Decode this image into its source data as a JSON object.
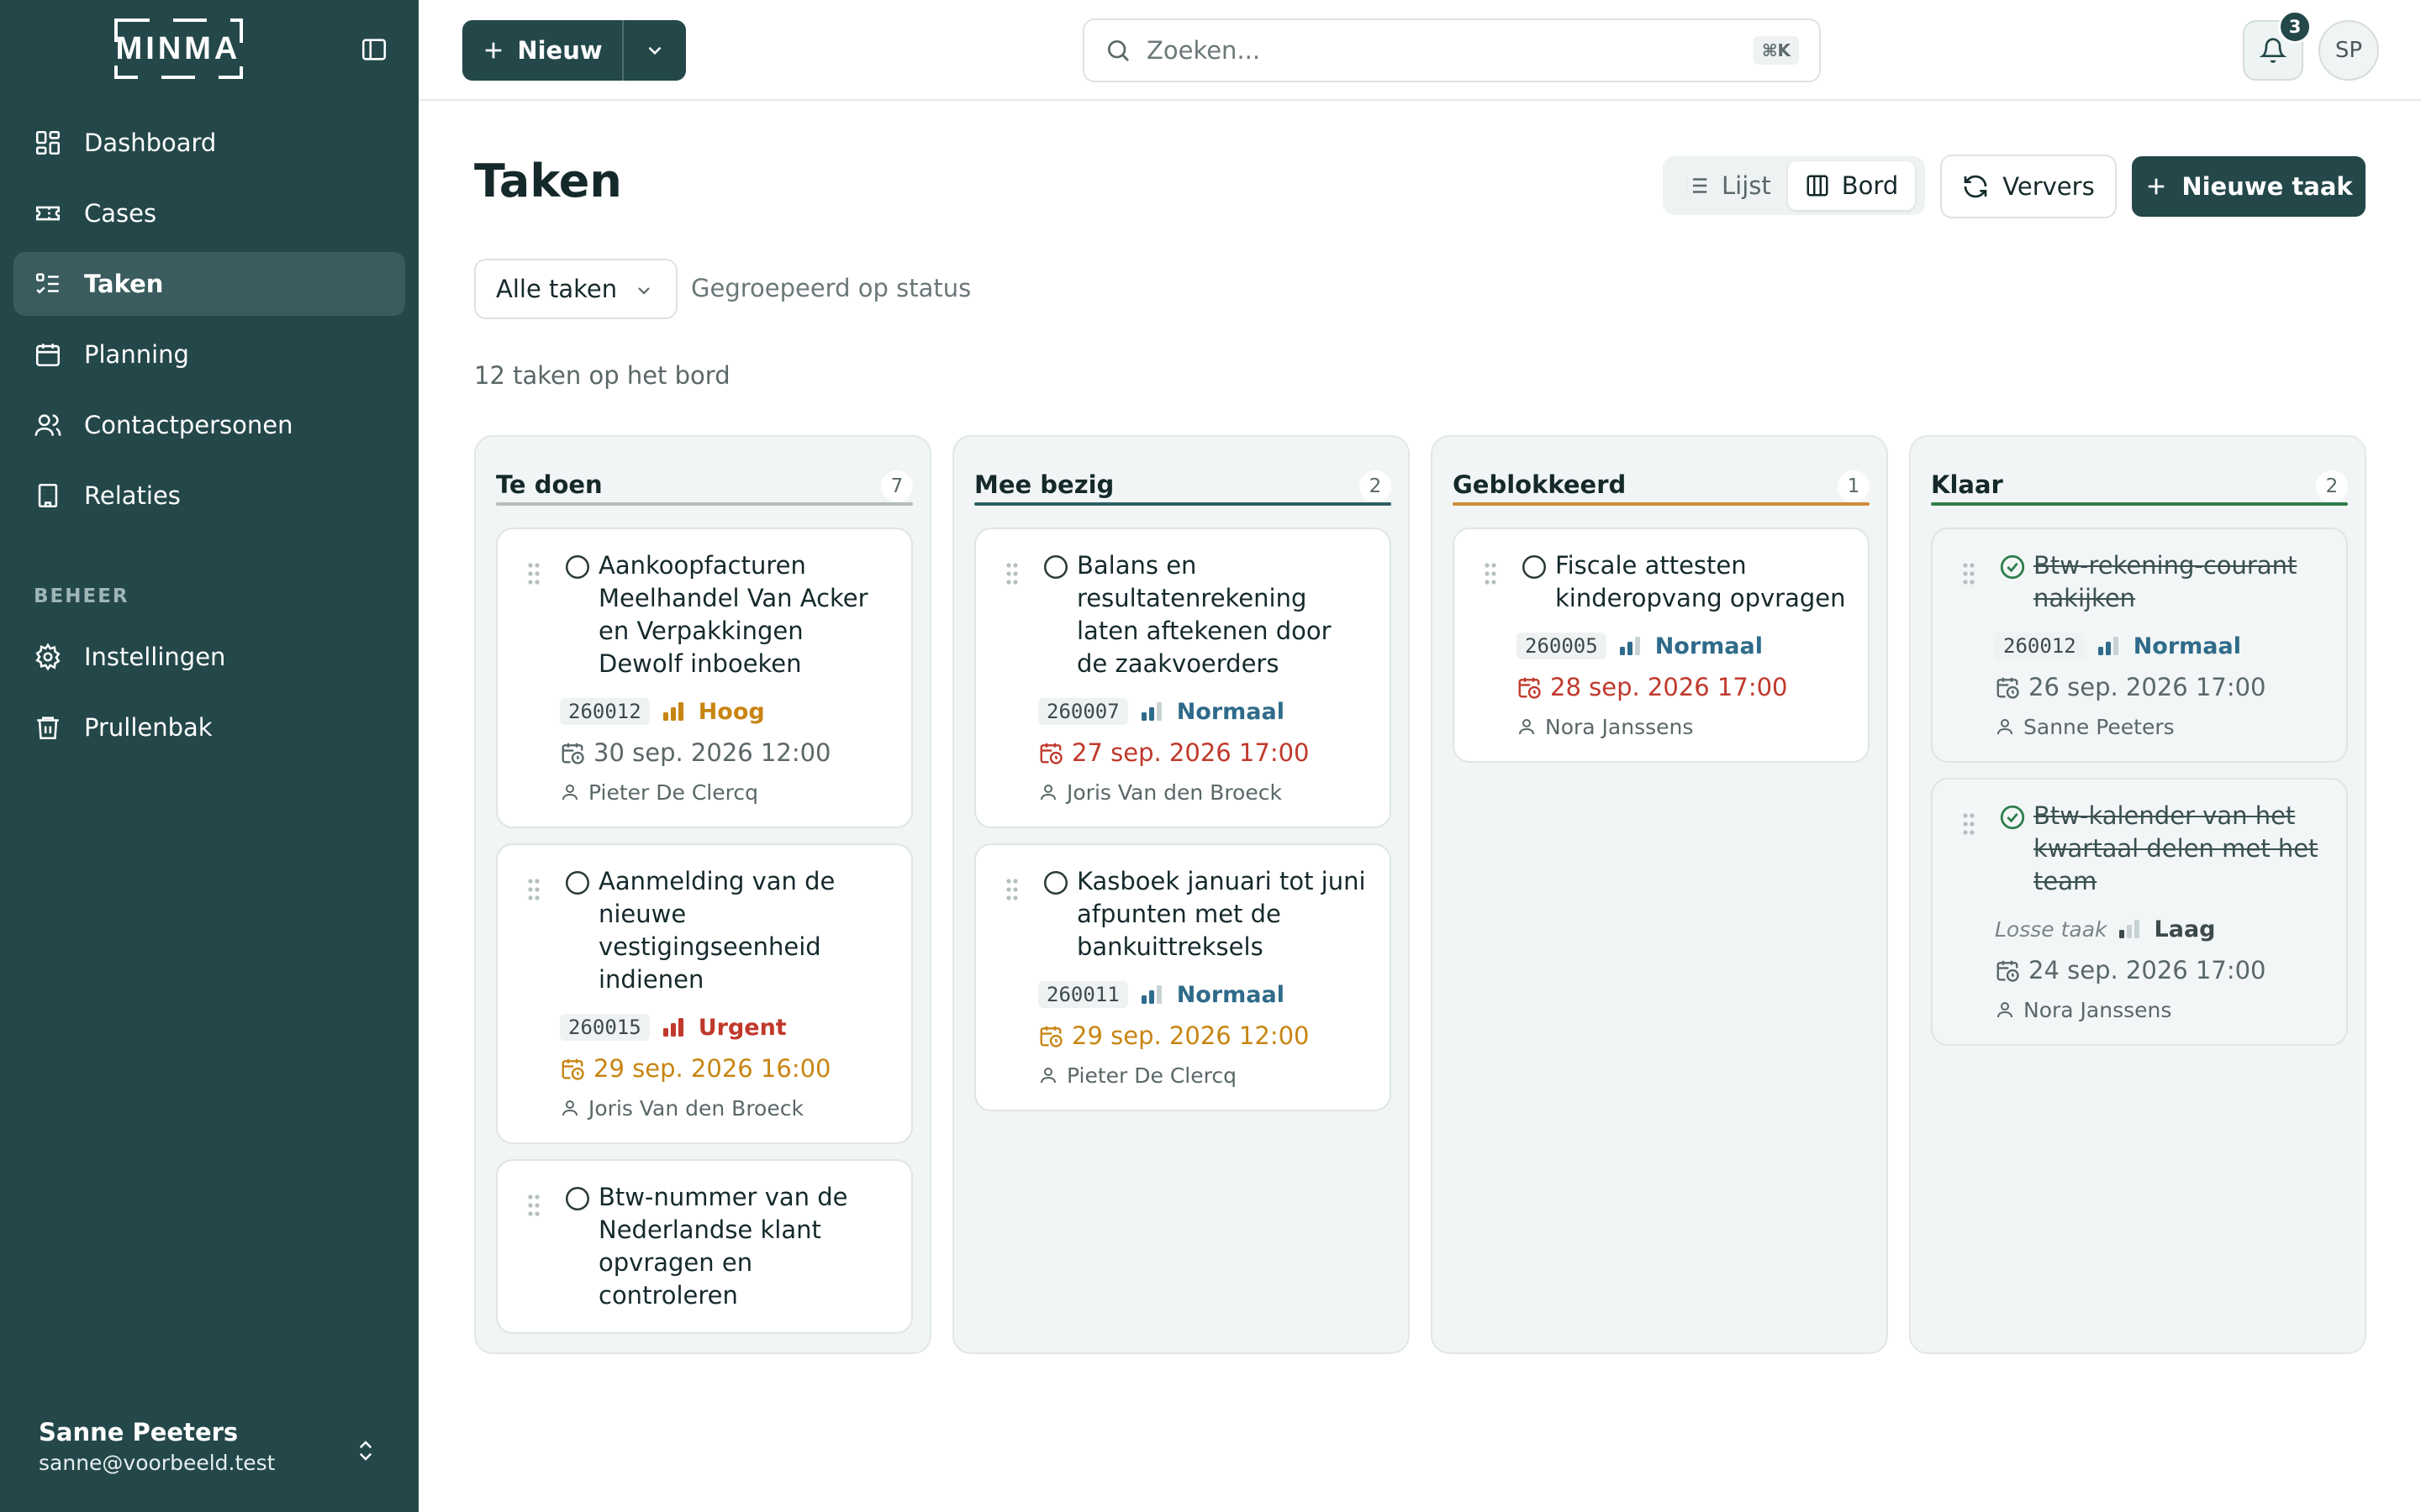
{
  "brand": {
    "logo_text": "MINMA"
  },
  "sidebar": {
    "items": [
      {
        "label": "Dashboard",
        "icon": "dashboard-icon"
      },
      {
        "label": "Cases",
        "icon": "ticket-icon"
      },
      {
        "label": "Taken",
        "icon": "tasks-icon"
      },
      {
        "label": "Planning",
        "icon": "calendar-icon"
      },
      {
        "label": "Contactpersonen",
        "icon": "users-icon"
      },
      {
        "label": "Relaties",
        "icon": "building-icon"
      }
    ],
    "section_label": "BEHEER",
    "admin_items": [
      {
        "label": "Instellingen",
        "icon": "gear-icon"
      },
      {
        "label": "Prullenbak",
        "icon": "trash-icon"
      }
    ],
    "user": {
      "name": "Sanne Peeters",
      "email": "sanne@voorbeeld.test"
    }
  },
  "topbar": {
    "new_label": "Nieuw",
    "search_placeholder": "Zoeken...",
    "search_shortcut": "⌘K",
    "notification_count": "3",
    "avatar_initials": "SP"
  },
  "page": {
    "title": "Taken",
    "view_toggle": {
      "list_label": "Lijst",
      "board_label": "Bord",
      "active": "Bord"
    },
    "refresh_label": "Ververs",
    "new_task_label": "Nieuwe taak",
    "filter": {
      "selected": "Alle taken"
    },
    "grouping_label": "Gegroepeerd op status",
    "count_label": "12 taken op het bord"
  },
  "colors": {
    "brand": "#24474a",
    "todo_line": "#b4bcbc",
    "busy_line": "#2f5f63",
    "blocked_line": "#d08a3c",
    "done_line": "#2e7d4c",
    "prio_high": "#c88512",
    "prio_normal": "#2f6b8a",
    "prio_urgent": "#c0392b",
    "prio_low": "#3d4a4b",
    "due_overdue": "#c0392b",
    "due_soon": "#c88512",
    "due_normal": "#5a6768"
  },
  "board": {
    "columns": [
      {
        "title": "Te doen",
        "count": "7",
        "cards": [
          {
            "title": "Aankoopfacturen Meelhandel Van Acker en Verpakkingen Dewolf inboeken",
            "code": "260012",
            "priority": "Hoog",
            "priority_level": "high",
            "due": "30 sep. 2026 12:00",
            "due_state": "normal",
            "assignee": "Pieter De Clercq",
            "done": false
          },
          {
            "title": "Aanmelding van de nieuwe vestigingseenheid indienen",
            "code": "260015",
            "priority": "Urgent",
            "priority_level": "urgent",
            "due": "29 sep. 2026 16:00",
            "due_state": "soon",
            "assignee": "Joris Van den Broeck",
            "done": false
          },
          {
            "title": "Btw-nummer van de Nederlandse klant opvragen en controleren",
            "done": false
          }
        ]
      },
      {
        "title": "Mee bezig",
        "count": "2",
        "cards": [
          {
            "title": "Balans en resultatenrekening laten aftekenen door de zaakvoerders",
            "code": "260007",
            "priority": "Normaal",
            "priority_level": "normal",
            "due": "27 sep. 2026 17:00",
            "due_state": "overdue",
            "assignee": "Joris Van den Broeck",
            "done": false
          },
          {
            "title": "Kasboek januari tot juni afpunten met de bankuittreksels",
            "code": "260011",
            "priority": "Normaal",
            "priority_level": "normal",
            "due": "29 sep. 2026 12:00",
            "due_state": "soon",
            "assignee": "Pieter De Clercq",
            "done": false
          }
        ]
      },
      {
        "title": "Geblokkeerd",
        "count": "1",
        "cards": [
          {
            "title": "Fiscale attesten kinderopvang opvragen",
            "code": "260005",
            "priority": "Normaal",
            "priority_level": "normal",
            "due": "28 sep. 2026 17:00",
            "due_state": "overdue",
            "assignee": "Nora Janssens",
            "done": false
          }
        ]
      },
      {
        "title": "Klaar",
        "count": "2",
        "cards": [
          {
            "title": "Btw-rekening-courant nakijken",
            "code": "260012",
            "priority": "Normaal",
            "priority_level": "normal",
            "due": "26 sep. 2026 17:00",
            "due_state": "normal",
            "assignee": "Sanne Peeters",
            "done": true
          },
          {
            "title": "Btw-kalender van het kwartaal delen met het team",
            "loose_label": "Losse taak",
            "priority": "Laag",
            "priority_level": "low",
            "due": "24 sep. 2026 17:00",
            "due_state": "normal",
            "assignee": "Nora Janssens",
            "done": true
          }
        ]
      }
    ]
  }
}
